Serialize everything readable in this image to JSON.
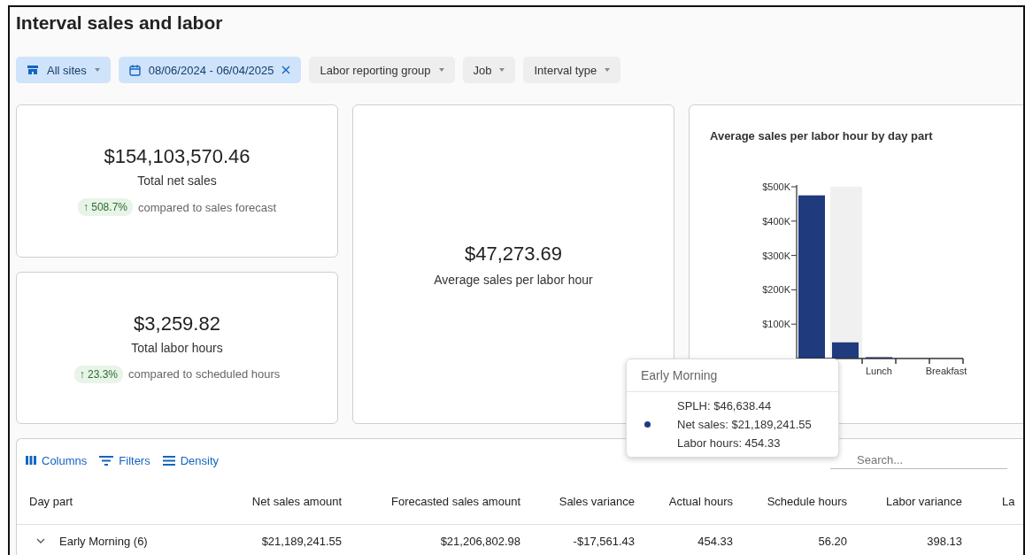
{
  "page": {
    "title": "Interval sales and labor"
  },
  "filters": [
    {
      "label": "All sites",
      "kind": "site",
      "active": true
    },
    {
      "label": "08/06/2024 - 06/04/2025",
      "kind": "date",
      "active": true
    },
    {
      "label": "Labor reporting group",
      "kind": "dropdown",
      "active": false
    },
    {
      "label": "Job",
      "kind": "dropdown",
      "active": false
    },
    {
      "label": "Interval type",
      "kind": "dropdown",
      "active": false
    }
  ],
  "kpis": [
    {
      "value": "$154,103,570.46",
      "label": "Total net sales",
      "change": "↑ 508.7%",
      "comparison": "compared to sales forecast"
    },
    {
      "value": "$3,259.82",
      "label": "Total labor hours",
      "change": "↑ 23.3%",
      "comparison": "compared to scheduled hours"
    }
  ],
  "average": {
    "value": "$47,273.69",
    "label": "Average sales per labor hour"
  },
  "chart": {
    "hovered": [
      false,
      true,
      false,
      false,
      false
    ],
    "chart_data": {
      "type": "bar",
      "title": "Average sales per labor hour by day part",
      "categories": [
        null,
        null,
        "Lunch",
        null,
        "Breakfast"
      ],
      "series": [
        {
          "color": "#1f3a7d",
          "values": [
            475000,
            47000,
            4000,
            0,
            0
          ]
        }
      ],
      "ylim": [
        0,
        500000
      ],
      "yticks": [
        {
          "value": 100000,
          "label": "$100K"
        },
        {
          "value": 200000,
          "label": "$200K"
        },
        {
          "value": 300000,
          "label": "$300K"
        },
        {
          "value": 400000,
          "label": "$400K"
        },
        {
          "value": 500000,
          "label": "$500K"
        }
      ]
    }
  },
  "tooltip": {
    "title": "Early Morning",
    "color": "#1f3a7d",
    "lines": [
      "SPLH: $46,638.44",
      "Net sales: $21,189,241.55",
      "Labor hours: 454.33"
    ]
  },
  "table": {
    "toolbar": [
      {
        "label": "Columns",
        "kind": "columns"
      },
      {
        "label": "Filters",
        "kind": "filters"
      },
      {
        "label": "Density",
        "kind": "density"
      }
    ],
    "search": {
      "placeholder": "Search..."
    },
    "columns": [
      "Day part",
      "Net sales amount",
      "Forecasted sales amount",
      "Sales variance",
      "Actual hours",
      "Schedule hours",
      "Labor variance",
      "La"
    ],
    "rows": [
      {
        "expanded": false,
        "cells": [
          "Early Morning (6)",
          "$21,189,241.55",
          "$21,206,802.98",
          "-$17,561.43",
          "454.33",
          "56.20",
          "398.13"
        ]
      }
    ]
  }
}
